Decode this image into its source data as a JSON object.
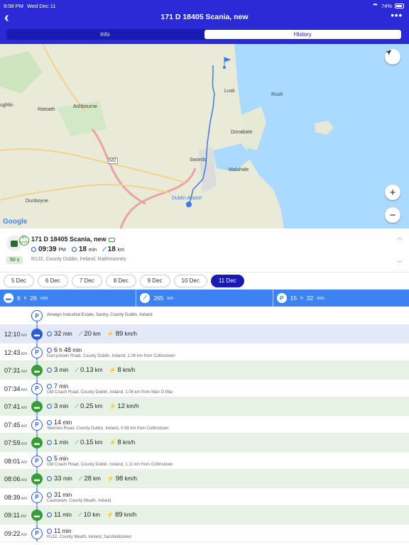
{
  "status": {
    "time": "9:58 PM",
    "date": "Wed Dec 11",
    "battery": "74%"
  },
  "header": {
    "title": "171 D 18405 Scania, new",
    "tabs": [
      "Info",
      "History"
    ],
    "active_tab": "History"
  },
  "map": {
    "labels": [
      "Lusk",
      "Rush",
      "Ratoath",
      "Ashbourne",
      "Donabate",
      "Swords",
      "Malahide",
      "Dunboyne",
      "Dublin Airport",
      "M2",
      "ughlin"
    ],
    "attribution": "Google",
    "zoom_in": "+",
    "zoom_out": "−"
  },
  "vehicle": {
    "name": "171 D 18405 Scania, new",
    "badge": "87 km/h",
    "time": "09:39",
    "ampm": "PM",
    "duration": "18",
    "duration_unit": "min",
    "distance": "18",
    "distance_unit": "km",
    "address": "R132, County Dublin, Ireland, Rathmooney",
    "ago": "50 s"
  },
  "days": [
    "5 Dec",
    "6 Dec",
    "7 Dec",
    "8 Dec",
    "9 Dec",
    "10 Dec",
    "11 Dec"
  ],
  "active_day": "11 Dec",
  "summary": {
    "drive": "6",
    "drive_unit1": "h",
    "drive_min": "26",
    "drive_unit2": "min",
    "distance": "265",
    "distance_unit": "km",
    "stop": "15",
    "stop_unit1": "h",
    "stop_min": "32",
    "stop_unit2": "min"
  },
  "first_stop": "Airways Industrial Estate, Santry, County Dublin, Ireland",
  "rows": [
    {
      "type": "drive",
      "time": "12:10",
      "ampm": "AM",
      "dur": "32",
      "dur_u": "min",
      "dist": "20",
      "dist_u": "km",
      "speed": "89",
      "speed_u": "km/h",
      "sel": true
    },
    {
      "type": "stop",
      "time": "12:43",
      "ampm": "AM",
      "dur": "6",
      "dur_u": "h",
      "dur2": "48",
      "dur2_u": "min",
      "addr": "Darcystown Road, County Dublin, Ireland, 1.06 km from Collinstown"
    },
    {
      "type": "drive",
      "time": "07:31",
      "ampm": "AM",
      "dur": "3",
      "dur_u": "min",
      "dist": "0.13",
      "dist_u": "km",
      "speed": "8",
      "speed_u": "km/h"
    },
    {
      "type": "stop",
      "time": "07:34",
      "ampm": "AM",
      "dur": "7",
      "dur_u": "min",
      "addr": "Old Coach Road, County Dublin, Ireland, 1.06 km from Man O War"
    },
    {
      "type": "drive",
      "time": "07:41",
      "ampm": "AM",
      "dur": "3",
      "dur_u": "min",
      "dist": "0.25",
      "dist_u": "km",
      "speed": "12",
      "speed_u": "km/h"
    },
    {
      "type": "stop",
      "time": "07:45",
      "ampm": "AM",
      "dur": "14",
      "dur_u": "min",
      "addr": "Skerries Road, County Dublin, Ireland, 0.98 km from Collinstown"
    },
    {
      "type": "drive",
      "time": "07:59",
      "ampm": "AM",
      "dur": "1",
      "dur_u": "min",
      "dist": "0.15",
      "dist_u": "km",
      "speed": "8",
      "speed_u": "km/h"
    },
    {
      "type": "stop",
      "time": "08:01",
      "ampm": "AM",
      "dur": "5",
      "dur_u": "min",
      "addr": "Old Coach Road, County Dublin, Ireland, 1.11 km from Collinstown"
    },
    {
      "type": "drive",
      "time": "08:06",
      "ampm": "AM",
      "dur": "33",
      "dur_u": "min",
      "dist": "28",
      "dist_u": "km",
      "speed": "98",
      "speed_u": "km/h"
    },
    {
      "type": "stop",
      "time": "08:39",
      "ampm": "AM",
      "dur": "31",
      "dur_u": "min",
      "addr": "Caulstown, County Meath, Ireland"
    },
    {
      "type": "drive",
      "time": "09:11",
      "ampm": "AM",
      "dur": "11",
      "dur_u": "min",
      "dist": "10",
      "dist_u": "km",
      "speed": "89",
      "speed_u": "km/h"
    },
    {
      "type": "stop",
      "time": "09:22",
      "ampm": "AM",
      "dur": "11",
      "dur_u": "min",
      "addr": "R132, County Meath, Ireland, Sarsfieldstown"
    }
  ],
  "colors": {
    "header": "#2a2bd6",
    "accent": "#3c82f0",
    "drive": "#3a9b3a",
    "route": "#3d7be8"
  }
}
